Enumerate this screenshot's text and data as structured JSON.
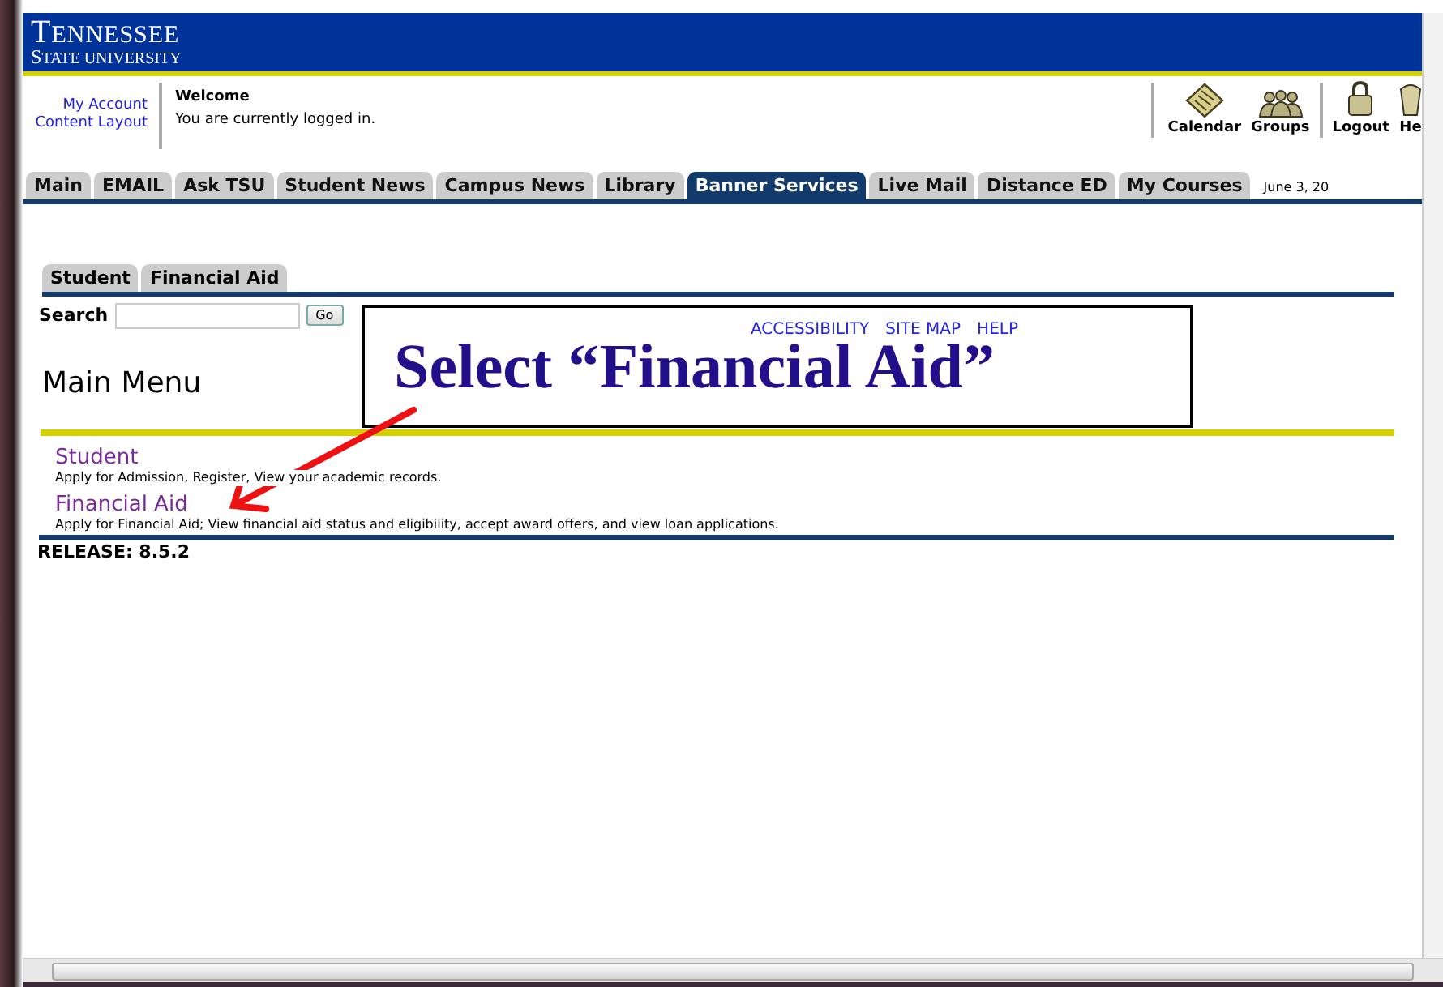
{
  "header": {
    "logo_line_1": "TENNESSEE",
    "logo_line_2": "STATE UNIVERSITY"
  },
  "user_links": [
    "My Account",
    "Content Layout"
  ],
  "welcome": {
    "title": "Welcome",
    "message": "You are currently logged in."
  },
  "toolbar": [
    {
      "label": "Calendar"
    },
    {
      "label": "Groups"
    },
    {
      "label": "Logout"
    },
    {
      "label": "He"
    }
  ],
  "tabs": [
    {
      "label": "Main",
      "selected": false
    },
    {
      "label": "EMAIL",
      "selected": false
    },
    {
      "label": "Ask TSU",
      "selected": false
    },
    {
      "label": "Student News",
      "selected": false
    },
    {
      "label": "Campus News",
      "selected": false
    },
    {
      "label": "Library",
      "selected": false
    },
    {
      "label": "Banner Services",
      "selected": true
    },
    {
      "label": "Live Mail",
      "selected": false
    },
    {
      "label": "Distance ED",
      "selected": false
    },
    {
      "label": "My Courses",
      "selected": false
    }
  ],
  "date": "June 3, 20",
  "subtabs": [
    {
      "label": "Student",
      "selected": false
    },
    {
      "label": "Financial Aid",
      "selected": false
    }
  ],
  "search": {
    "label": "Search",
    "button": "Go"
  },
  "top_links": [
    "ACCESSIBILITY",
    "SITE MAP",
    "HELP"
  ],
  "heading": "Main Menu",
  "menu": [
    {
      "title": "Student",
      "description": "Apply for Admission, Register, View your academic records."
    },
    {
      "title": "Financial Aid",
      "description": "Apply for Financial Aid; View financial aid status and eligibility, accept award offers, and view loan applications."
    }
  ],
  "release": "RELEASE: 8.5.2",
  "callout": "Select “Financial Aid”"
}
